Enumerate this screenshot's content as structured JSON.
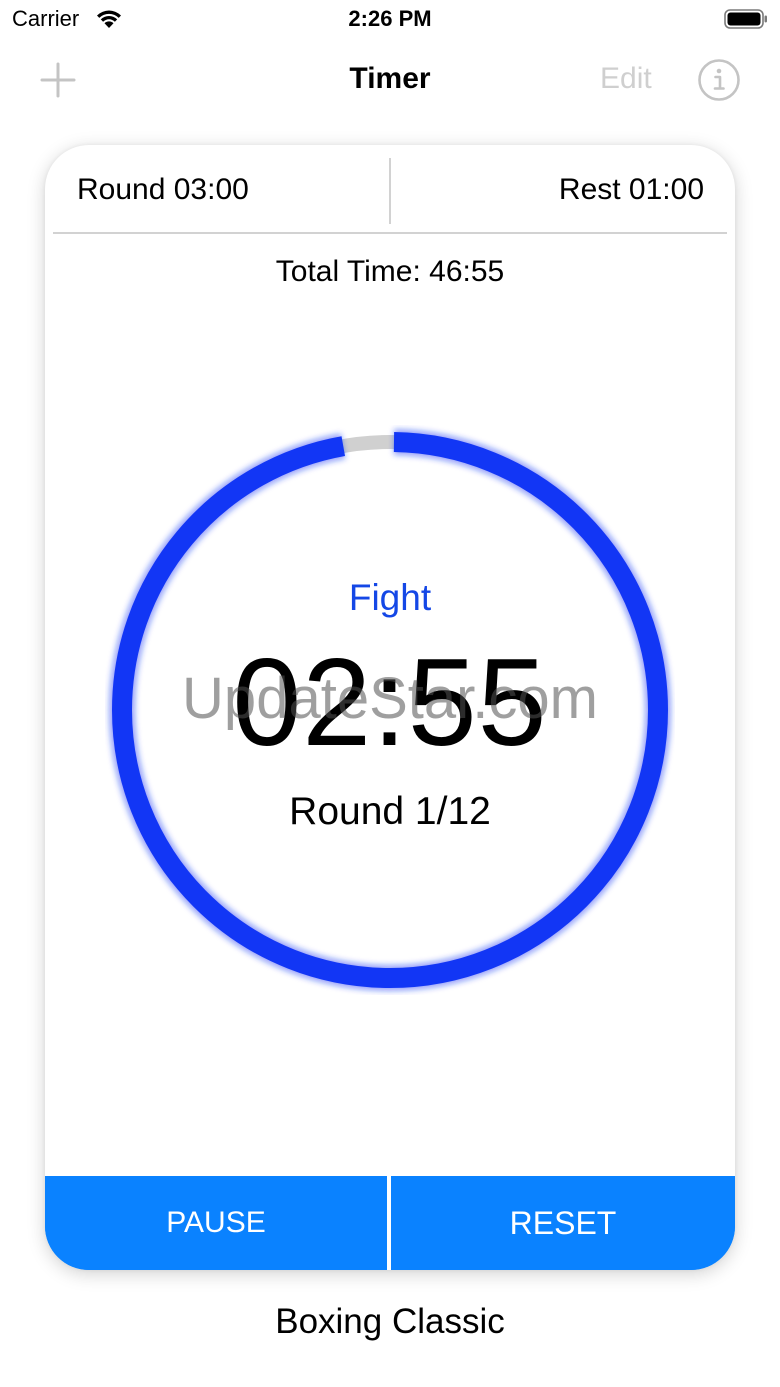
{
  "status_bar": {
    "carrier": "Carrier",
    "time": "2:26 PM",
    "wifi_icon": "wifi-icon",
    "battery_icon": "battery-icon"
  },
  "nav": {
    "title": "Timer",
    "edit_label": "Edit",
    "add_icon": "plus-icon",
    "info_icon": "info-icon"
  },
  "card": {
    "round_setting": "Round 03:00",
    "rest_setting": "Rest 01:00",
    "total_time": "Total Time: 46:55",
    "phase": "Fight",
    "time_remaining": "02:55",
    "round_counter": "Round 1/12",
    "watermark": "UpdateStar.com",
    "progress_fraction": 0.972,
    "colors": {
      "ring": "#1236f5",
      "ring_track": "#d0d0d0",
      "phase_label": "#1447e6",
      "buttons": "#0a82ff"
    }
  },
  "controls": {
    "pause_label": "PAUSE",
    "reset_label": "RESET"
  },
  "preset": {
    "name": "Boxing Classic"
  }
}
